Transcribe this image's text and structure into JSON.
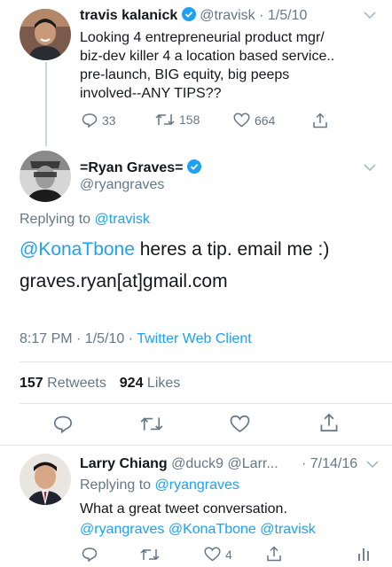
{
  "tweet1": {
    "name": "travis kalanick",
    "handle": "@travisk",
    "date": "· 1/5/10",
    "text_lines": [
      "Looking 4 entrepreneurial product mgr/",
      "biz-dev killer 4 a location based service..",
      "pre-launch, BIG equity, big peeps",
      "involved--ANY TIPS??"
    ],
    "replies": "33",
    "retweets": "158",
    "likes": "664"
  },
  "main_tweet": {
    "name": "=Ryan Graves=",
    "handle": "@ryangraves",
    "replying_prefix": "Replying to",
    "replying_to": "@travisk",
    "mention": "@KonaTbone",
    "text_line1_rest": " heres a tip. email me :)",
    "text_line2": "graves.ryan[at]gmail.com",
    "timestamp": "8:17 PM · 1/5/10 ·",
    "client": "Twitter Web Client",
    "retweets_count": "157",
    "retweets_label": "Retweets",
    "likes_count": "924",
    "likes_label": "Likes"
  },
  "reply": {
    "name": "Larry Chiang",
    "handle": "@duck9 @Larr...",
    "date": "· 7/14/16",
    "replying_prefix": "Replying to",
    "replying_to": "@ryangraves",
    "text": "What a great tweet conversation.",
    "mentions": "@ryangraves @KonaTbone @travisk",
    "likes": "4"
  },
  "colors": {
    "accent": "#1da1f2",
    "secondary": "#657786",
    "divider": "#e1e8ed"
  }
}
